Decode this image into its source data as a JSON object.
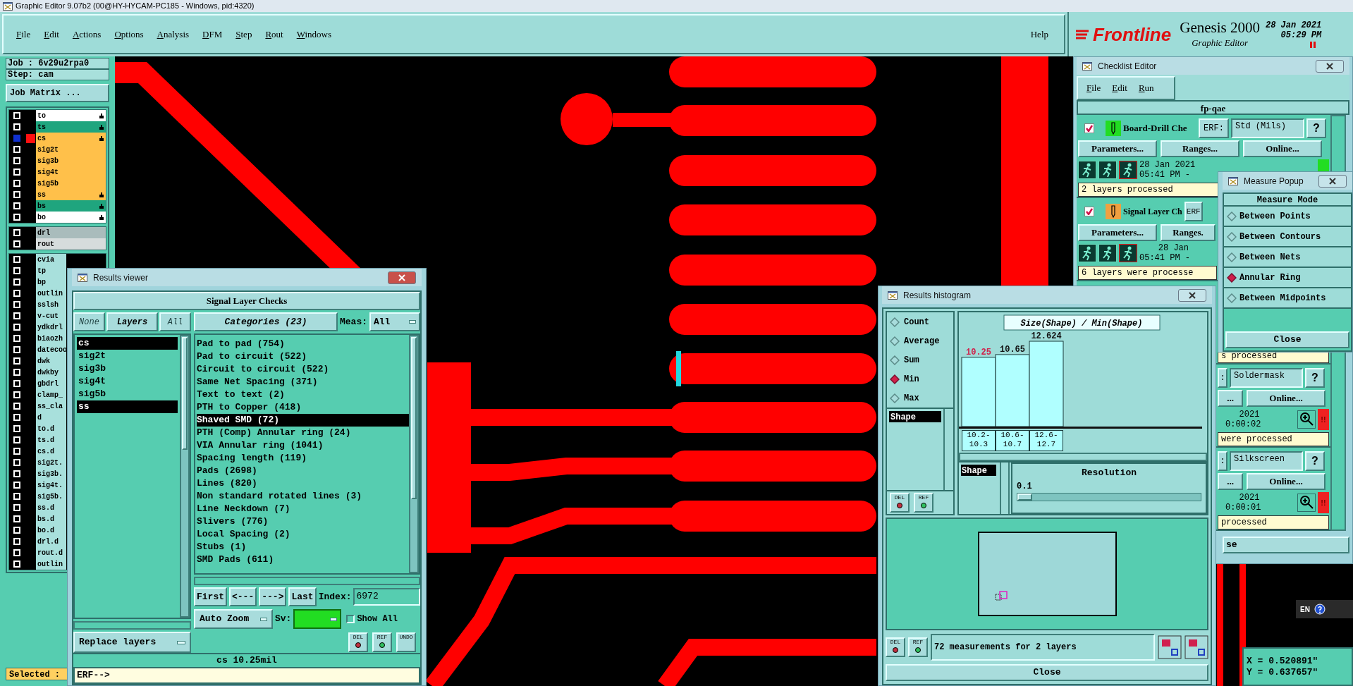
{
  "window": {
    "title": "Graphic Editor 9.07b2 (00@HY-HYCAM-PC185 - Windows, pid:4320)"
  },
  "menu": [
    "File",
    "Edit",
    "Actions",
    "Options",
    "Analysis",
    "DFM",
    "Step",
    "Rout",
    "Windows"
  ],
  "help_menu": "Help",
  "brand": {
    "logo": "Frontline",
    "product": "Genesis 2000",
    "subtitle": "Graphic Editor",
    "date": "28 Jan 2021",
    "time": "05:29 PM"
  },
  "job_panel": {
    "job": "Job : 6v29u2rpa0",
    "step": "Step: cam",
    "matrix_button": "Job Matrix ...",
    "selected_label": "Selected :",
    "layer_groups": [
      [
        {
          "name": "to",
          "color": "#ffffff",
          "selected": false,
          "marked": true
        },
        {
          "name": "ts",
          "color": "#1fa57e",
          "selected": false,
          "marked": true
        },
        {
          "name": "cs",
          "color": "#ffc04a",
          "selected": true,
          "marked": true
        },
        {
          "name": "sig2t",
          "color": "#ffc04a",
          "selected": false,
          "marked": false
        },
        {
          "name": "sig3b",
          "color": "#ffc04a",
          "selected": false,
          "marked": false
        },
        {
          "name": "sig4t",
          "color": "#ffc04a",
          "selected": false,
          "marked": false
        },
        {
          "name": "sig5b",
          "color": "#ffc04a",
          "selected": false,
          "marked": false
        },
        {
          "name": "ss",
          "color": "#ffc04a",
          "selected": false,
          "marked": true
        },
        {
          "name": "bs",
          "color": "#1fa57e",
          "selected": false,
          "marked": true
        },
        {
          "name": "bo",
          "color": "#ffffff",
          "selected": false,
          "marked": true
        }
      ],
      [
        {
          "name": "drl",
          "color": "#a9bcbc",
          "selected": false,
          "marked": false
        },
        {
          "name": "rout",
          "color": "#d6dcdc",
          "selected": false,
          "marked": false
        }
      ],
      [
        {
          "name": "cvia",
          "color": "#a8e0dc",
          "selected": false,
          "marked": false
        },
        {
          "name": "tp",
          "color": "#a8e0dc",
          "selected": false,
          "marked": false
        },
        {
          "name": "bp",
          "color": "#a8e0dc",
          "selected": false,
          "marked": false
        },
        {
          "name": "outlin",
          "color": "#a8e0dc",
          "selected": false,
          "marked": false
        },
        {
          "name": "sslsh",
          "color": "#a8e0dc",
          "selected": false,
          "marked": false
        },
        {
          "name": "v-cut",
          "color": "#a8e0dc",
          "selected": false,
          "marked": false
        },
        {
          "name": "ydkdrl",
          "color": "#a8e0dc",
          "selected": false,
          "marked": false
        },
        {
          "name": "biaozh",
          "color": "#a8e0dc",
          "selected": false,
          "marked": false
        },
        {
          "name": "datecoo",
          "color": "#a8e0dc",
          "selected": false,
          "marked": false
        },
        {
          "name": "dwk",
          "color": "#a8e0dc",
          "selected": false,
          "marked": false
        },
        {
          "name": "dwkby",
          "color": "#a8e0dc",
          "selected": false,
          "marked": false
        },
        {
          "name": "gbdrl",
          "color": "#a8e0dc",
          "selected": false,
          "marked": false
        },
        {
          "name": "clamp_",
          "color": "#a8e0dc",
          "selected": false,
          "marked": false
        },
        {
          "name": "ss_cla",
          "color": "#a8e0dc",
          "selected": false,
          "marked": false
        },
        {
          "name": "d",
          "color": "#a8e0dc",
          "selected": false,
          "marked": false
        },
        {
          "name": "to.d",
          "color": "#a8e0dc",
          "selected": false,
          "marked": false
        },
        {
          "name": "ts.d",
          "color": "#a8e0dc",
          "selected": false,
          "marked": false
        },
        {
          "name": "cs.d",
          "color": "#a8e0dc",
          "selected": false,
          "marked": false
        },
        {
          "name": "sig2t.",
          "color": "#a8e0dc",
          "selected": false,
          "marked": false
        },
        {
          "name": "sig3b.",
          "color": "#a8e0dc",
          "selected": false,
          "marked": false
        },
        {
          "name": "sig4t.",
          "color": "#a8e0dc",
          "selected": false,
          "marked": false
        },
        {
          "name": "sig5b.",
          "color": "#a8e0dc",
          "selected": false,
          "marked": false
        },
        {
          "name": "ss.d",
          "color": "#a8e0dc",
          "selected": false,
          "marked": false
        },
        {
          "name": "bs.d",
          "color": "#a8e0dc",
          "selected": false,
          "marked": false
        },
        {
          "name": "bo.d",
          "color": "#a8e0dc",
          "selected": false,
          "marked": false
        },
        {
          "name": "drl.d",
          "color": "#a8e0dc",
          "selected": false,
          "marked": false
        },
        {
          "name": "rout.d",
          "color": "#a8e0dc",
          "selected": false,
          "marked": false
        },
        {
          "name": "outlin",
          "color": "#a8e0dc",
          "selected": false,
          "marked": false
        }
      ]
    ]
  },
  "results_viewer": {
    "title": "Results viewer",
    "header": "Signal Layer Checks",
    "layer_buttons": [
      {
        "label": "None",
        "disabled": true
      },
      {
        "label": "Layers",
        "disabled": false
      },
      {
        "label": "All",
        "disabled": true
      }
    ],
    "layers": [
      {
        "name": "cs",
        "selected": true
      },
      {
        "name": "sig2t",
        "selected": false
      },
      {
        "name": "sig3b",
        "selected": false
      },
      {
        "name": "sig4t",
        "selected": false
      },
      {
        "name": "sig5b",
        "selected": false
      },
      {
        "name": "ss",
        "selected": true
      }
    ],
    "categories_button": "Categories (23)",
    "meas_label": "Meas:",
    "meas_value": "All",
    "categories": [
      {
        "label": "Pad to pad (754)",
        "selected": false
      },
      {
        "label": "Pad to circuit (522)",
        "selected": false
      },
      {
        "label": "Circuit to circuit (522)",
        "selected": false
      },
      {
        "label": "Same Net Spacing (371)",
        "selected": false
      },
      {
        "label": "Text to text (2)",
        "selected": false
      },
      {
        "label": "PTH to Copper (418)",
        "selected": false
      },
      {
        "label": "Shaved SMD (72)",
        "selected": true
      },
      {
        "label": "PTH (Comp) Annular ring (24)",
        "selected": false
      },
      {
        "label": "VIA Annular ring (1041)",
        "selected": false
      },
      {
        "label": "Spacing length (119)",
        "selected": false
      },
      {
        "label": "Pads (2698)",
        "selected": false
      },
      {
        "label": "Lines (820)",
        "selected": false
      },
      {
        "label": "Non standard rotated lines (3)",
        "selected": false
      },
      {
        "label": "Line Neckdown (7)",
        "selected": false
      },
      {
        "label": "Slivers (776)",
        "selected": false
      },
      {
        "label": "Local Spacing (2)",
        "selected": false
      },
      {
        "label": "Stubs (1)",
        "selected": false
      },
      {
        "label": "SMD Pads (611)",
        "selected": false
      }
    ],
    "nav": [
      "First",
      "<---",
      "--->",
      "Last"
    ],
    "index_label": "Index:",
    "index_value": "6972",
    "zoom_mode": "Auto Zoom",
    "sv_label": "Sv:",
    "show_all": {
      "label": "Show All",
      "checked": false
    },
    "tools": [
      "DEL",
      "REF",
      "UNDO"
    ],
    "replace_mode": "Replace layers",
    "status": "cs 10.25mil",
    "erf_prompt": "ERF-->"
  },
  "histogram": {
    "title": "Results histogram",
    "functions": [
      {
        "label": "Count",
        "selected": false
      },
      {
        "label": "Average",
        "selected": false
      },
      {
        "label": "Sum",
        "selected": false
      },
      {
        "label": "Min",
        "selected": true
      },
      {
        "label": "Max",
        "selected": false
      }
    ],
    "fields": [
      {
        "label": "Shape",
        "selected": true
      }
    ],
    "list_tools": [
      "DEL",
      "REF"
    ],
    "chart_data": {
      "type": "bar",
      "title": "Size(Shape) / Min(Shape)",
      "categories": [
        "10.2-10.3",
        "10.6-10.7",
        "12.6-12.7"
      ],
      "values": [
        10.25,
        10.65,
        12.624
      ],
      "data_labels": true
    },
    "bars": [
      {
        "selected": true
      },
      {
        "selected": false
      },
      {
        "selected": false
      }
    ],
    "axis_fields": [
      {
        "label": "Shape",
        "selected": true
      }
    ],
    "resolution_label": "Resolution",
    "resolution_value": "0.1",
    "resolution_slider": {
      "level": 0.08
    },
    "bottom_tools": [
      "DEL",
      "REF"
    ],
    "summary": "72 measurements for 2 layers",
    "close": "Close"
  },
  "checklist": {
    "title": "Checklist Editor",
    "menu": [
      "File",
      "Edit",
      "Run"
    ],
    "name": "fp-qae",
    "rows": [
      {
        "kind": "full",
        "checked": true,
        "color": "#22dd22",
        "name": "Board-Drill Che",
        "erf": "ERF:",
        "standard": "Std (Mils)",
        "help": "?",
        "buttons": [
          "Parameters...",
          "Ranges...",
          "Online..."
        ],
        "date": "28 Jan 2021",
        "time": "05:41 PM -",
        "status": "2 layers processed",
        "passed": true
      },
      {
        "kind": "clipped_right",
        "checked": true,
        "color": "#f0a040",
        "name": "Signal Layer Ch",
        "erf": "ERF",
        "buttons": [
          "Parameters...",
          "Ranges."
        ],
        "date": "28 Jan",
        "time": "05:41 PM -",
        "status": "6 layers were processe"
      },
      {
        "kind": "clipped_left",
        "status": "s processed"
      },
      {
        "kind": "clipped_left",
        "erf": ":",
        "standard": "Soldermask",
        "help": "?",
        "buttons": [
          "...",
          "Online..."
        ],
        "date": "2021",
        "time": "0:00:02",
        "status": "were processed",
        "passed": false,
        "alert": "!!"
      },
      {
        "kind": "clipped_left",
        "erf": ":",
        "standard": "Silkscreen",
        "help": "?",
        "buttons": [
          "...",
          "Online..."
        ],
        "date": "2021",
        "time": "0:00:01",
        "status": "processed",
        "passed": false,
        "alert": "!!"
      }
    ],
    "close": "se"
  },
  "measure_popup": {
    "title": "Measure Popup",
    "heading": "Measure Mode",
    "modes": [
      {
        "label": "Between Points",
        "selected": false
      },
      {
        "label": "Between Contours",
        "selected": false
      },
      {
        "label": "Between Nets",
        "selected": false
      },
      {
        "label": "Annular Ring",
        "selected": true
      },
      {
        "label": "Between Midpoints",
        "selected": false
      }
    ],
    "close": "Close"
  },
  "coordinates": {
    "x": "X = 0.520891\"",
    "y": "Y = 0.637657\""
  },
  "language_bar": {
    "label": "EN"
  }
}
